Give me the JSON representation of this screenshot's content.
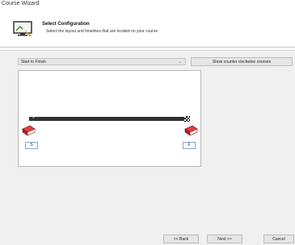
{
  "window": {
    "title": "Course Wizard"
  },
  "header": {
    "title": "Select Configuration",
    "subtitle": "Select the layout and timelines that are located on your course"
  },
  "layout_select": {
    "value": "Start to Finish"
  },
  "toolbar": {
    "counter_clockwise_label": "Show counter clockwise courses"
  },
  "course": {
    "start_tag": "S",
    "finish_tag": "F"
  },
  "footer": {
    "back_label": "<< Back",
    "next_label": "Next >>",
    "cancel_label": "Cancel"
  },
  "icons": {
    "header": "wizard-monitor-icon",
    "start": "book-icon",
    "finish": "book-icon",
    "arrow": "right-arrow-icon",
    "flag": "checkered-flag-icon"
  },
  "colors": {
    "book": "#c8282a",
    "track": "#303030"
  }
}
